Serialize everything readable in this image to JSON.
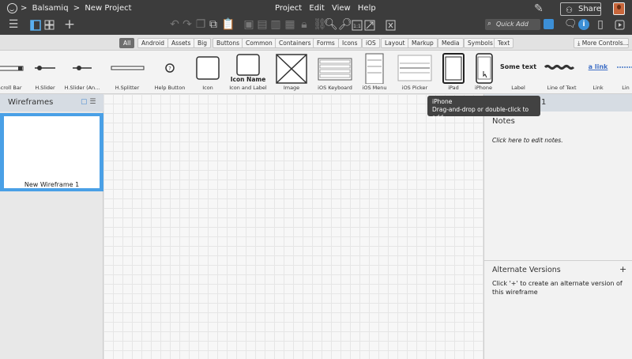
{
  "header": {
    "breadcrumb": [
      ">",
      "Balsamiq",
      ">",
      "New Project"
    ],
    "menu": [
      "Project",
      "Edit",
      "View",
      "Help"
    ],
    "share_label": "Share",
    "quick_add_placeholder": "Quick Add"
  },
  "toolbar": {
    "icons": [
      "hamburger-menu-icon",
      "single-view-icon",
      "grid-view-icon",
      "add-icon",
      "undo-icon",
      "redo-icon",
      "duplicate-icon",
      "copy-icon",
      "paste-icon",
      "group-icon",
      "ungroup-icon",
      "bring-front-icon",
      "send-back-icon",
      "lock-icon",
      "link-icon",
      "zoom-out-icon",
      "zoom-in-icon",
      "actual-size-icon",
      "fit-icon",
      "delete-icon",
      "pen-icon",
      "comment-icon",
      "info-icon",
      "present-icon"
    ]
  },
  "categories": {
    "items": [
      "All",
      "Android",
      "Assets",
      "Big",
      "Buttons",
      "Common",
      "Containers",
      "Forms",
      "Icons",
      "iOS",
      "Layout",
      "Markup",
      "Media",
      "Symbols",
      "Text"
    ],
    "active": "All",
    "more_controls": "More Controls..."
  },
  "library": {
    "components": [
      {
        "label": "Scroll Bar"
      },
      {
        "label": "H.Slider"
      },
      {
        "label": "H.Slider (An..."
      },
      {
        "label": "H.Splitter"
      },
      {
        "label": "Help Button"
      },
      {
        "label": "Icon"
      },
      {
        "label": "Icon and Label",
        "preview_text": "Icon Name"
      },
      {
        "label": "Image"
      },
      {
        "label": "iOS Keyboard"
      },
      {
        "label": "iOS Menu"
      },
      {
        "label": "iOS Picker"
      },
      {
        "label": "iPad"
      },
      {
        "label": "iPhone"
      },
      {
        "label": "Label",
        "preview_text": "Some text"
      },
      {
        "label": "Line of Text"
      },
      {
        "label": "Link",
        "preview_text": "a link"
      },
      {
        "label": "Lin"
      }
    ]
  },
  "tooltip": {
    "title": "iPhone",
    "hint": "Drag-and-drop or double-click to add"
  },
  "wireframes_panel": {
    "title": "Wireframes",
    "items": [
      {
        "name": "New Wireframe 1"
      }
    ]
  },
  "right_panel": {
    "title": "1",
    "notes_title": "Notes",
    "notes_placeholder": "Click here to edit notes.",
    "alt_title": "Alternate Versions",
    "alt_add": "+",
    "alt_hint": "Click '+' to create an alternate version of this wireframe"
  }
}
